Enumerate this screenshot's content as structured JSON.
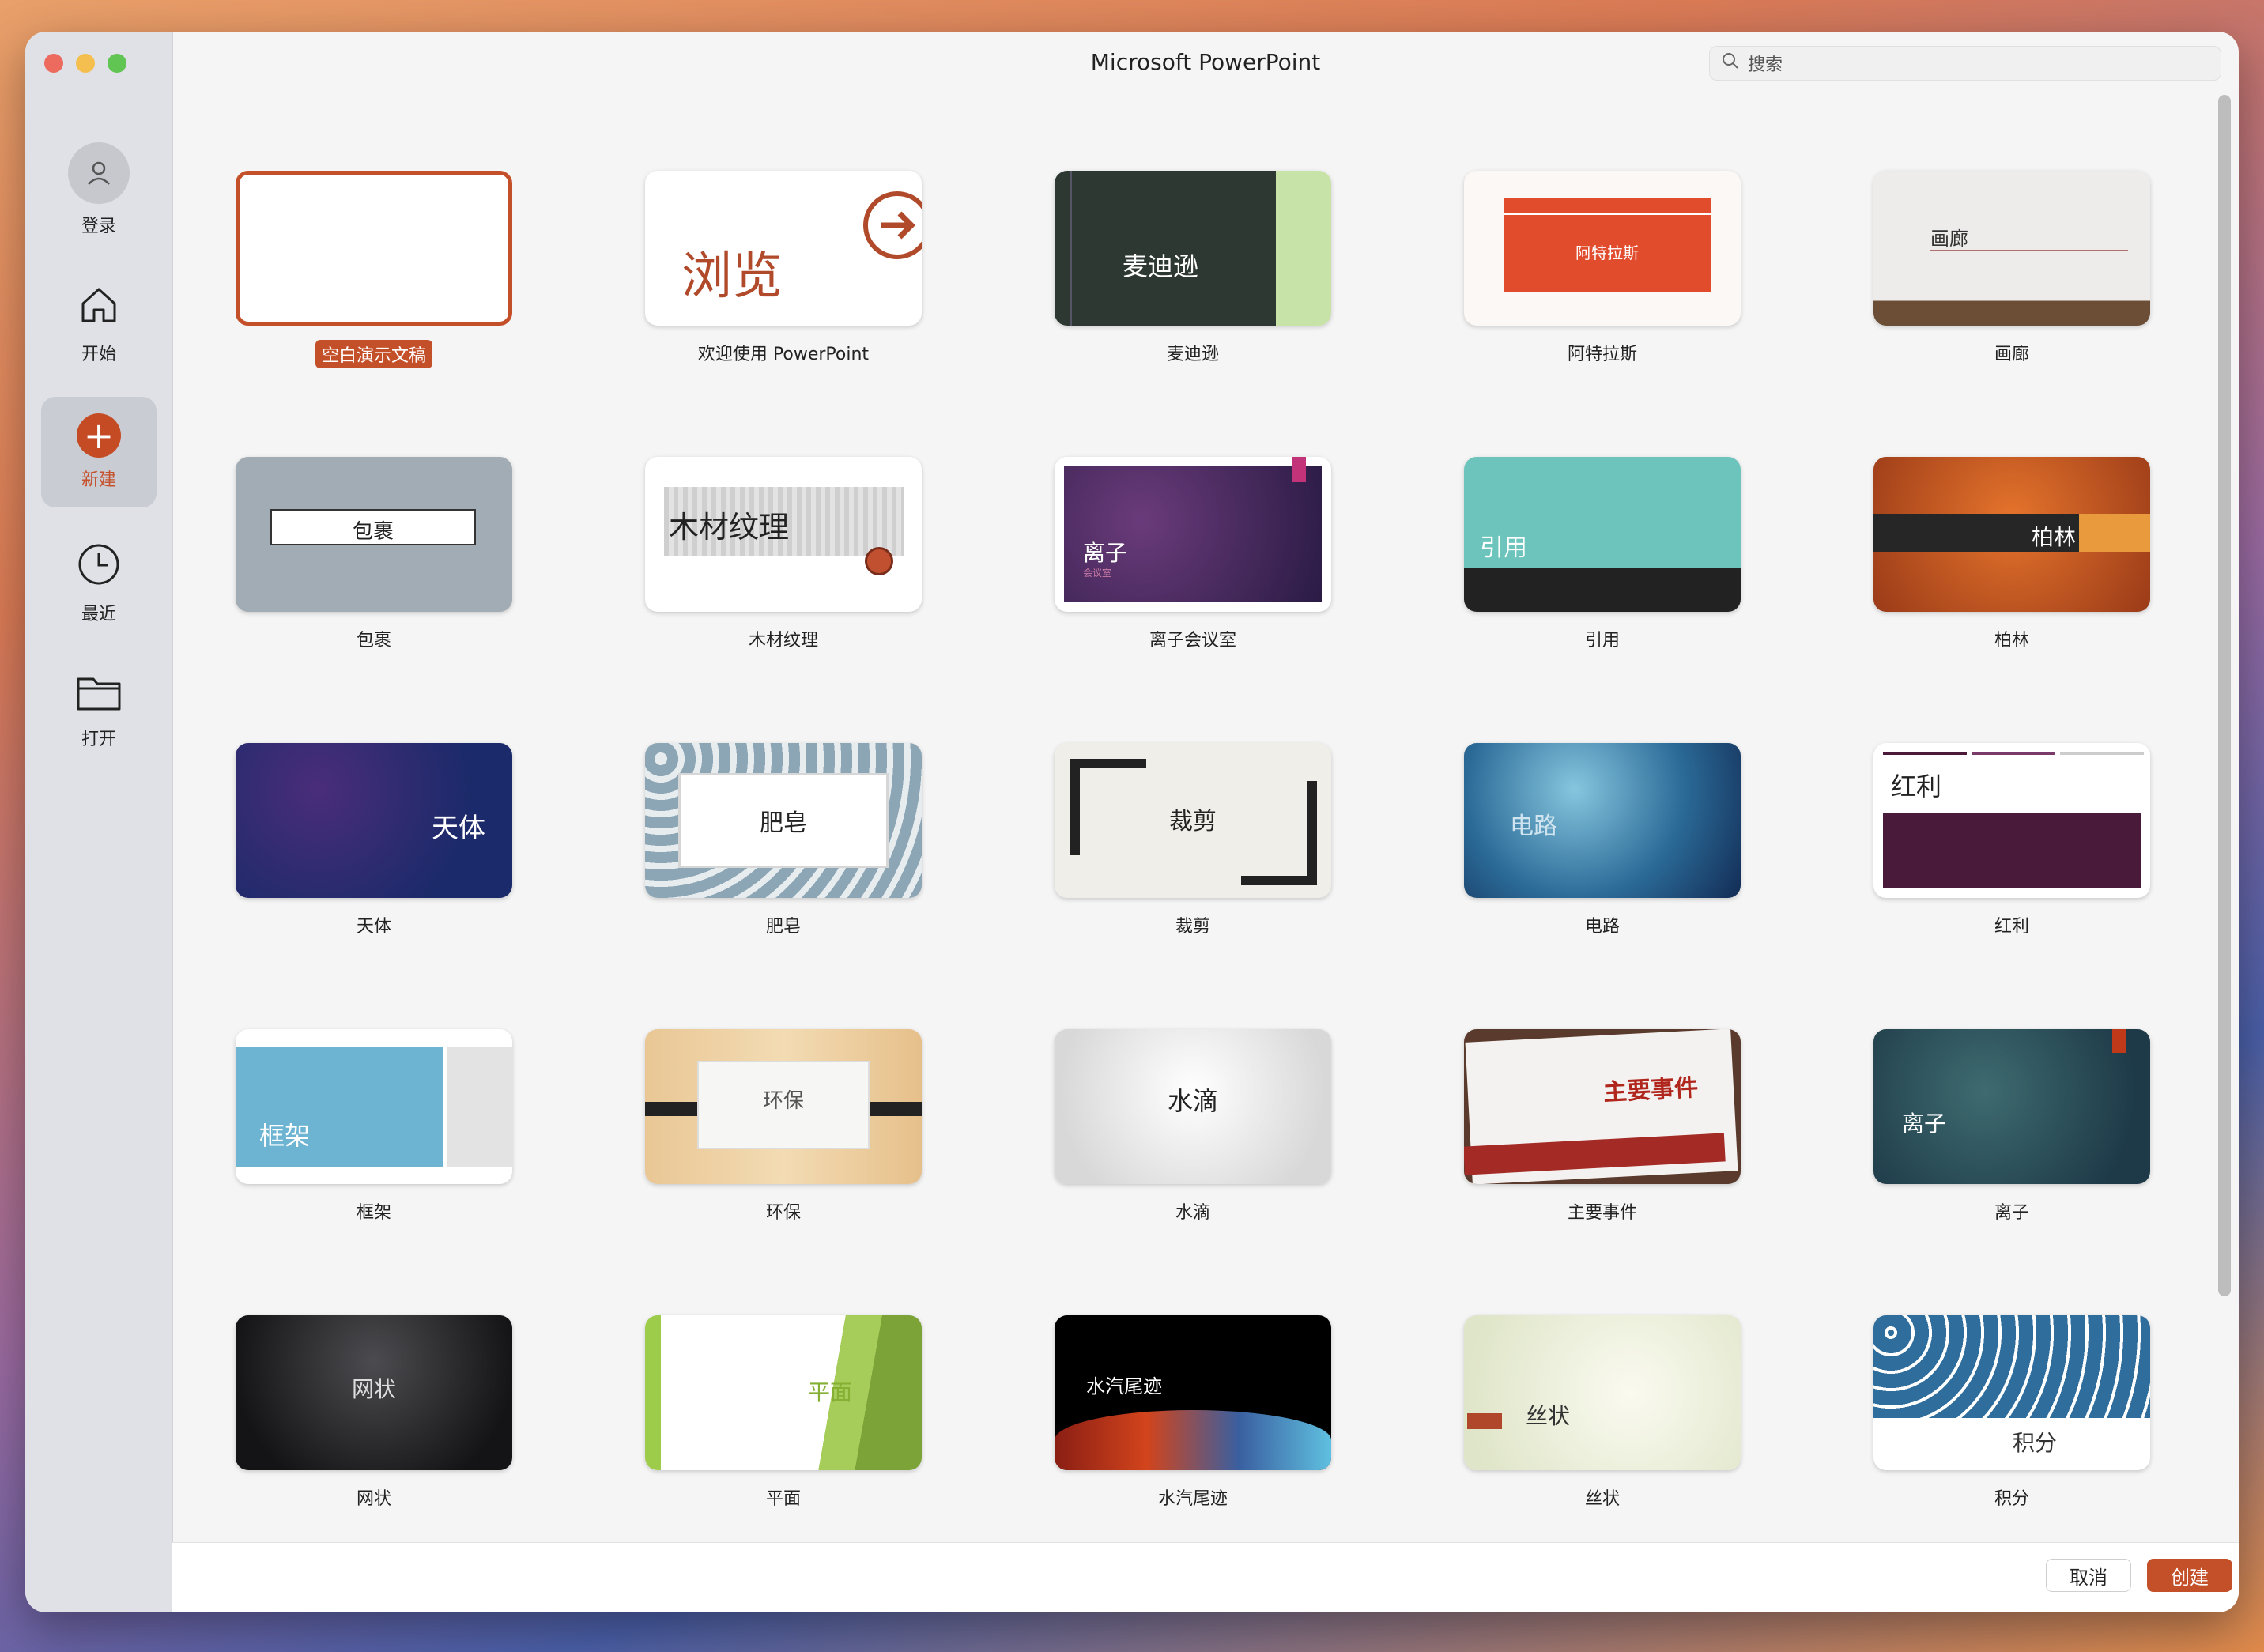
{
  "window": {
    "title": "Microsoft PowerPoint"
  },
  "search": {
    "placeholder": "搜索"
  },
  "sidebar": {
    "items": [
      {
        "label": "登录",
        "icon": "user-icon"
      },
      {
        "label": "开始",
        "icon": "home-icon"
      },
      {
        "label": "新建",
        "icon": "plus-icon",
        "active": true
      },
      {
        "label": "最近",
        "icon": "clock-icon"
      },
      {
        "label": "打开",
        "icon": "folder-icon"
      }
    ]
  },
  "templates": [
    {
      "caption": "空白演示文稿",
      "selected": true
    },
    {
      "caption": "欢迎使用 PowerPoint",
      "thumb_text": "浏览"
    },
    {
      "caption": "麦迪逊",
      "thumb_text": "麦迪逊"
    },
    {
      "caption": "阿特拉斯",
      "thumb_text": "阿特拉斯"
    },
    {
      "caption": "画廊",
      "thumb_text": "画廊"
    },
    {
      "caption": "包裹",
      "thumb_text": "包裹"
    },
    {
      "caption": "木材纹理",
      "thumb_text": "木材纹理"
    },
    {
      "caption": "离子会议室",
      "thumb_text": "离子",
      "thumb_sub": "会议室"
    },
    {
      "caption": "引用",
      "thumb_text": "引用"
    },
    {
      "caption": "柏林",
      "thumb_text": "柏林"
    },
    {
      "caption": "天体",
      "thumb_text": "天体"
    },
    {
      "caption": "肥皂",
      "thumb_text": "肥皂"
    },
    {
      "caption": "裁剪",
      "thumb_text": "裁剪"
    },
    {
      "caption": "电路",
      "thumb_text": "电路"
    },
    {
      "caption": "红利",
      "thumb_text": "红利"
    },
    {
      "caption": "框架",
      "thumb_text": "框架"
    },
    {
      "caption": "环保",
      "thumb_text": "环保"
    },
    {
      "caption": "水滴",
      "thumb_text": "水滴"
    },
    {
      "caption": "主要事件",
      "thumb_text": "主要事件"
    },
    {
      "caption": "离子",
      "thumb_text": "离子"
    },
    {
      "caption": "网状",
      "thumb_text": "网状"
    },
    {
      "caption": "平面",
      "thumb_text": "平面"
    },
    {
      "caption": "水汽尾迹",
      "thumb_text": "水汽尾迹"
    },
    {
      "caption": "丝状",
      "thumb_text": "丝状"
    },
    {
      "caption": "积分",
      "thumb_text": "积分"
    }
  ],
  "footer": {
    "cancel_label": "取消",
    "create_label": "创建"
  },
  "colors": {
    "accent": "#c4502a"
  }
}
